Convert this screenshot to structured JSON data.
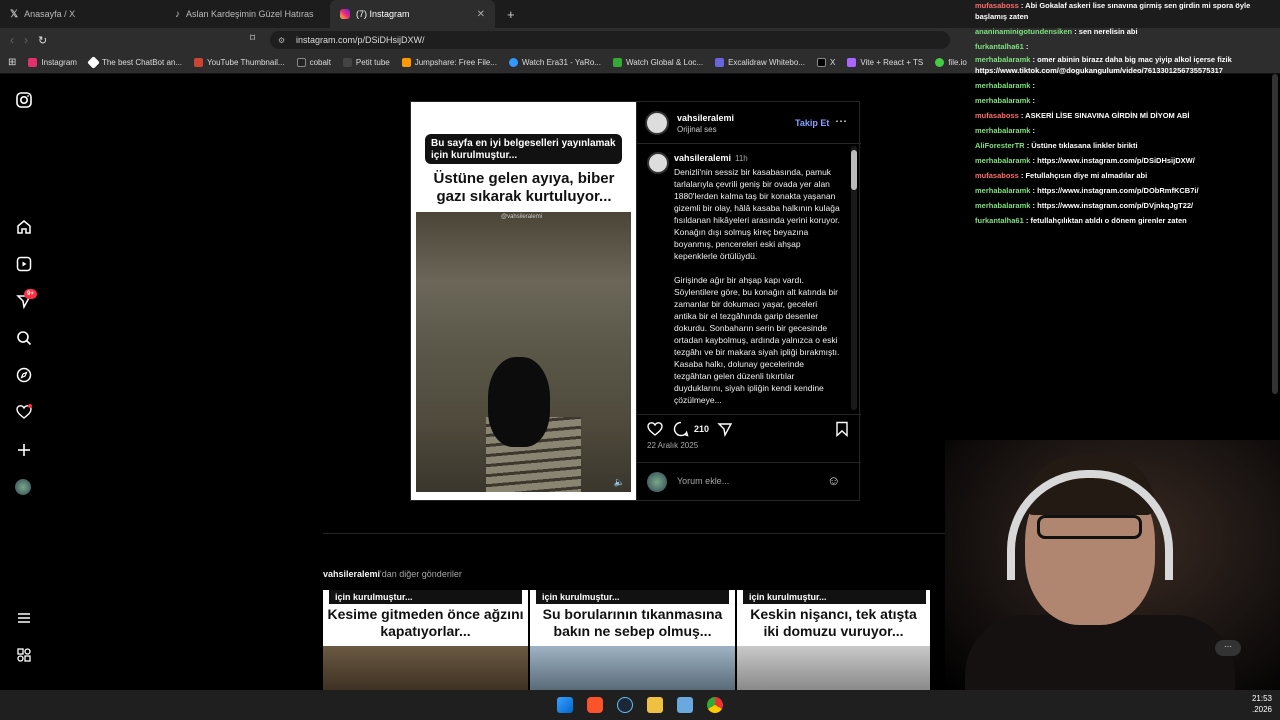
{
  "tabs": [
    {
      "label": "Anasayfa / X",
      "icon": "x-logo-icon"
    },
    {
      "label": "Aslan Kardeşimin Güzel Hatırası | Tik",
      "icon": "tiktok-icon"
    },
    {
      "label": "(7) Instagram",
      "icon": "instagram-icon",
      "active": true
    }
  ],
  "address": {
    "url": "instagram.com/p/DSiDHsijDXW/"
  },
  "bookmarks": [
    "Instagram",
    "The best ChatBot an...",
    "YouTube Thumbnail...",
    "cobalt",
    "Petit tube",
    "Jumpshare: Free File...",
    "Watch Era31 - YaRo...",
    "Watch Global & Loc...",
    "Excalidraw Whitebo...",
    "X",
    "Vite + React + TS",
    "file.io"
  ],
  "sidebar": {
    "notification_badge": "9+"
  },
  "post": {
    "badge_text": "Bu sayfa en iyi belgeselleri yayınlamak için kurulmuştur...",
    "headline": "Üstüne gelen ayıya, biber gazı sıkarak kurtuluyor...",
    "watermark": "@vahsileralemi",
    "username": "vahsileralemi",
    "subtitle": "Orijinal ses",
    "follow_label": "Takip Et",
    "caption_user": "vahsileralemi",
    "caption_time": "11h",
    "caption_p1": "Denizli'nin sessiz bir kasabasında, pamuk tarlalarıyla çevrili geniş bir ovada yer alan 1880'lerden kalma taş bir konakta yaşanan gizemli bir olay, hâlâ kasaba halkının kulağa fısıldanan hikâyeleri arasında yerini koruyor. Konağın dışı solmuş kireç beyazına boyanmış, pencereleri eski ahşap kepenklerle örtülüydü.",
    "caption_p2": "Girişinde ağır bir ahşap kapı vardı. Söylentilere göre, bu konağın alt katında bir zamanlar bir dokumacı yaşar, geceleri antika bir el tezgâhında garip desenler dokurdu. Sonbaharın serin bir gecesinde ortadan kaybolmuş, ardında yalnızca o eski tezgâhı ve bir makara siyah ipliği bırakmıştı. Kasaba halkı, dolunay gecelerinde tezgâhtan gelen düzenli tıkırtılar duyduklarını, siyah ipliğin kendi kendine çözülmeye...",
    "comment_count": "210",
    "date": "22 Aralık 2025",
    "comment_placeholder": "Yorum ekle..."
  },
  "more_posts": {
    "title_user": "vahsileralemi",
    "title_rest": "'dan diğer gönderiler",
    "items": [
      {
        "badge": "için kurulmuştur...",
        "headline": "Kesime gitmeden önce ağzını kapatıyorlar..."
      },
      {
        "badge": "için kurulmuştur...",
        "headline": "Su borularının tıkanmasına bakın ne sebep olmuş..."
      },
      {
        "badge": "için kurulmuştur...",
        "headline": "Keskin nişancı, tek atışta iki domuzu vuruyor..."
      }
    ]
  },
  "chat": [
    {
      "user": "mufasaboss",
      "color": "red",
      "text": ": Abi Gokalaf askeri lise sınavına girmiş sen girdin mi spora öyle başlamış zaten"
    },
    {
      "user": "ananinaminigotundensiken",
      "color": "green",
      "text": ": sen nerelisin abi"
    },
    {
      "user": "furkantalha61",
      "color": "green",
      "text": ":"
    },
    {
      "user": "merhabalaramk",
      "color": "green",
      "text": ": omer abinin birazz daha big mac yiyip alkol içerse fizik https://www.tiktok.com/@dogukangulum/video/7613301256735575317"
    },
    {
      "user": "merhabalaramk",
      "color": "green",
      "text": ":"
    },
    {
      "user": "merhabalaramk",
      "color": "green",
      "text": ":"
    },
    {
      "user": "mufasaboss",
      "color": "red",
      "text": ": ASKERİ LİSE SINAVINA GİRDİN Mİ DİYOM ABİ"
    },
    {
      "user": "merhabalaramk",
      "color": "green",
      "text": ":"
    },
    {
      "user": "AliForesterTR",
      "color": "green",
      "text": ": Üstüne tıklasana linkler birikti"
    },
    {
      "user": "merhabalaramk",
      "color": "green",
      "text": ": https://www.instagram.com/p/DSiDHsijDXW/"
    },
    {
      "user": "mufasaboss",
      "color": "red",
      "text": ": Fetullahçısın diye mi almadılar abi"
    },
    {
      "user": "merhabalaramk",
      "color": "green",
      "text": ": https://www.instagram.com/p/DObRmfKCB7i/"
    },
    {
      "user": "merhabalaramk",
      "color": "green",
      "text": ": https://www.instagram.com/p/DVjnkqJgT22/"
    },
    {
      "user": "furkantalha61",
      "color": "green",
      "text": ": fetullahçılıktan atıldı o dönem girenler zaten"
    }
  ],
  "clock": {
    "time": "21:53",
    "date": ".2026"
  },
  "colors": {
    "follow": "#85a1ff",
    "chat_user": "#7ee07e",
    "chat_user_alt": "#ff6b6b",
    "badge_red": "#ff3040"
  }
}
